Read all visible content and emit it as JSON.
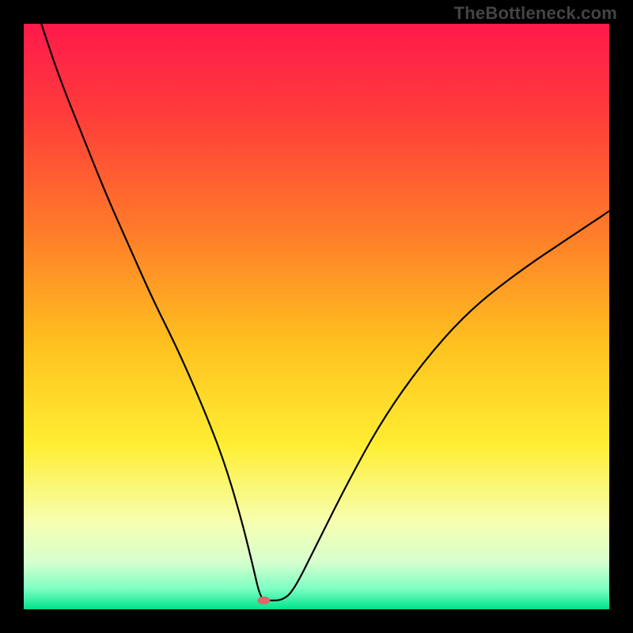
{
  "watermark": "TheBottleneck.com",
  "chart_data": {
    "type": "line",
    "title": "",
    "xlabel": "",
    "ylabel": "",
    "xlim": [
      0,
      100
    ],
    "ylim": [
      0,
      100
    ],
    "grid": false,
    "legend": false,
    "annotations": [],
    "background_gradient_stops": [
      {
        "offset": 0.0,
        "color": "#ff1a4b"
      },
      {
        "offset": 0.15,
        "color": "#ff3b3b"
      },
      {
        "offset": 0.35,
        "color": "#ff7a2a"
      },
      {
        "offset": 0.55,
        "color": "#ffc21f"
      },
      {
        "offset": 0.72,
        "color": "#ffee33"
      },
      {
        "offset": 0.85,
        "color": "#f7ffb0"
      },
      {
        "offset": 0.92,
        "color": "#d6ffcf"
      },
      {
        "offset": 0.965,
        "color": "#7dffc3"
      },
      {
        "offset": 1.0,
        "color": "#00e38a"
      }
    ],
    "series": [
      {
        "name": "bottleneck-curve",
        "x": [
          3,
          6,
          10,
          14,
          18,
          22,
          26,
          30,
          34,
          37,
          39,
          40.5,
          42,
          44,
          46,
          50,
          55,
          61,
          68,
          76,
          85,
          94,
          100
        ],
        "y": [
          100,
          91,
          81,
          71,
          62,
          53,
          45,
          36,
          26,
          16,
          8,
          1.5,
          1.5,
          1.5,
          3,
          11,
          21,
          32,
          42,
          51,
          58,
          64,
          68
        ]
      }
    ],
    "marker": {
      "x": 41,
      "y": 1.5,
      "color": "#d66a6a",
      "rx": 8,
      "ry": 5
    }
  }
}
